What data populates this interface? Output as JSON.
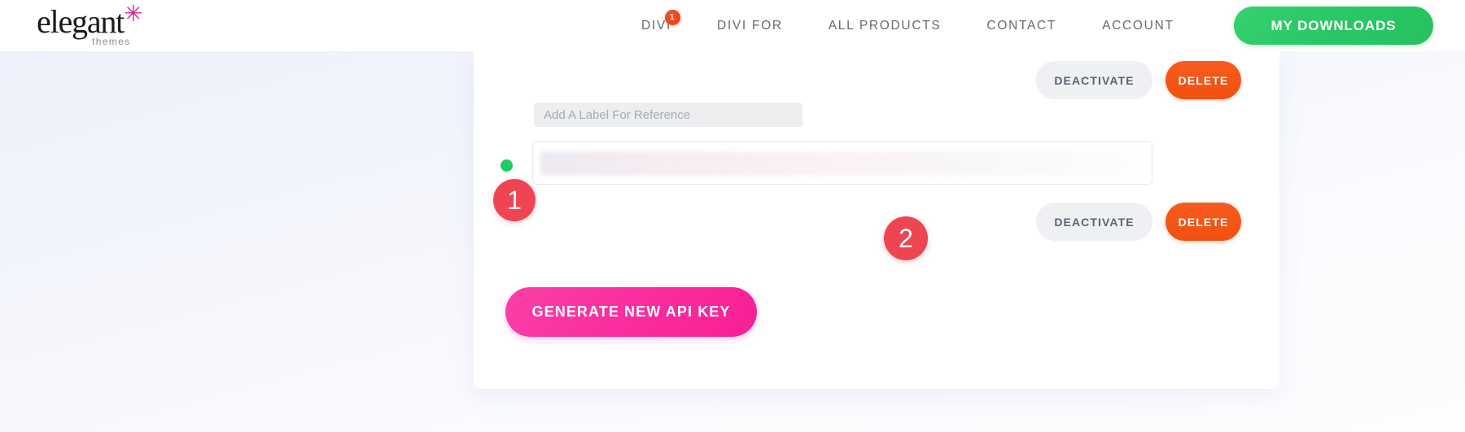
{
  "header": {
    "logo": {
      "word": "elegant",
      "star": "✳",
      "sub": "themes"
    },
    "nav": [
      {
        "label": "DIVI",
        "badge": "1"
      },
      {
        "label": "DIVI FOR",
        "badge": ""
      },
      {
        "label": "ALL PRODUCTS",
        "badge": ""
      },
      {
        "label": "CONTACT",
        "badge": ""
      },
      {
        "label": "ACCOUNT",
        "badge": ""
      }
    ],
    "downloads_button": "MY DOWNLOADS"
  },
  "card": {
    "top_actions": {
      "deactivate_label": "DEACTIVATE",
      "delete_label": "DELETE"
    },
    "label_field": {
      "placeholder": "Add A Label For Reference",
      "value": ""
    },
    "api_key_row": {
      "status": "active",
      "key_value": ""
    },
    "bottom_actions": {
      "deactivate_label": "DEACTIVATE",
      "delete_label": "DELETE"
    },
    "generate_button": "GENERATE NEW API KEY"
  },
  "callouts": [
    {
      "number": "1"
    },
    {
      "number": "2"
    }
  ],
  "colors": {
    "delete": "#f2500f",
    "deactivate_bg": "#eff0f4",
    "generate": "#fa2fa0",
    "downloads": "#2bc765",
    "callout": "#ef4552",
    "status_dot": "#1fcb63",
    "nav_badge": "#e8400f"
  }
}
